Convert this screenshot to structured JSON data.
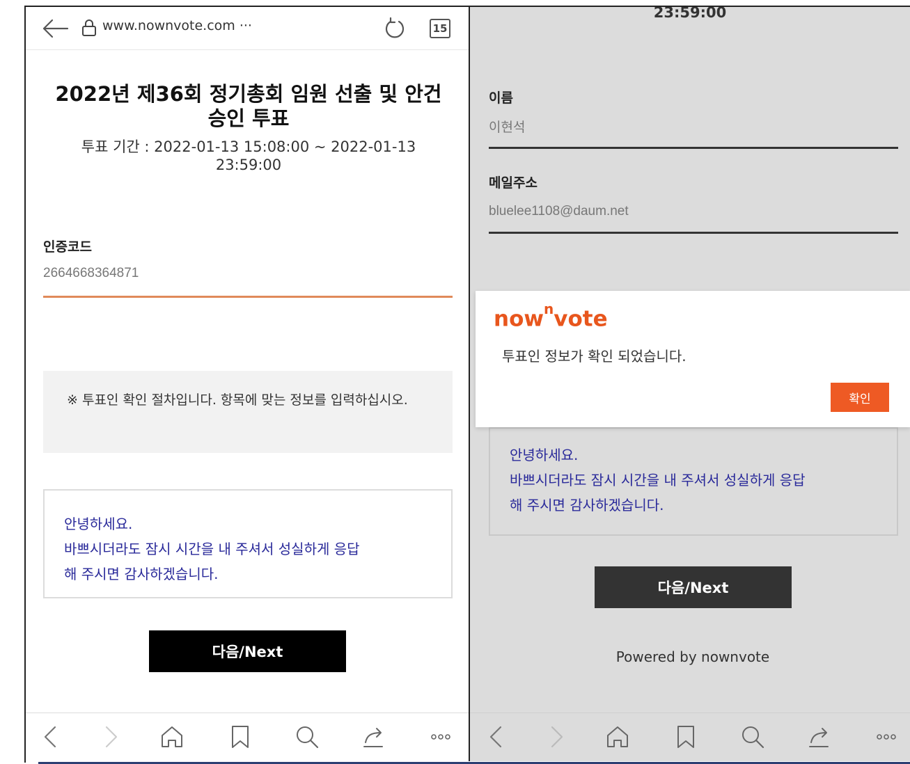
{
  "left": {
    "browser": {
      "url": "www.nownvote.com ···",
      "tab_count": "15"
    },
    "title": "2022년 제36회 정기총회 임원 선출 및 안건 승인 투표",
    "period": "투표 기간 : 2022-01-13 15:08:00 ~ 2022-01-13 23:59:00",
    "auth_label": "인증코드",
    "auth_value": "2664668364871",
    "notice": "※ 투표인 확인 절차입니다. 항목에 맞는 정보를 입력하십시오.",
    "greeting_line1": "안녕하세요.",
    "greeting_line2": "바쁘시더라도 잠시 시간을 내 주셔서 성실하게 응답",
    "greeting_line3": "해 주시면 감사하겠습니다.",
    "next_label": "다음/Next"
  },
  "right": {
    "time_top": "23:59:00",
    "name_label": "이름",
    "name_value": "이현석",
    "email_label": "메일주소",
    "email_value": "bluelee1108@daum.net",
    "dialog": {
      "brand_prefix": "now",
      "brand_sup": "n",
      "brand_suffix": "vote",
      "message": "투표인 정보가 확인 되었습니다.",
      "confirm_label": "확인"
    },
    "greeting_line1": "안녕하세요.",
    "greeting_line2": "바쁘시더라도 잠시 시간을 내 주셔서 성실하게 응답",
    "greeting_line3": "해 주시면 감사하겠습니다.",
    "next_label": "다음/Next",
    "powered_by": "Powered by nownvote"
  },
  "colors": {
    "accent": "#ee5a24",
    "brand": "#e8561d",
    "greeting_text": "#2a2a9a",
    "left_button": "#000000",
    "right_button": "#333333"
  },
  "icons": [
    "back-arrow-icon",
    "lock-icon",
    "reload-icon",
    "tab-count-icon",
    "nav-back-icon",
    "nav-forward-icon",
    "home-icon",
    "bookmark-icon",
    "search-icon",
    "share-icon",
    "more-icon"
  ]
}
